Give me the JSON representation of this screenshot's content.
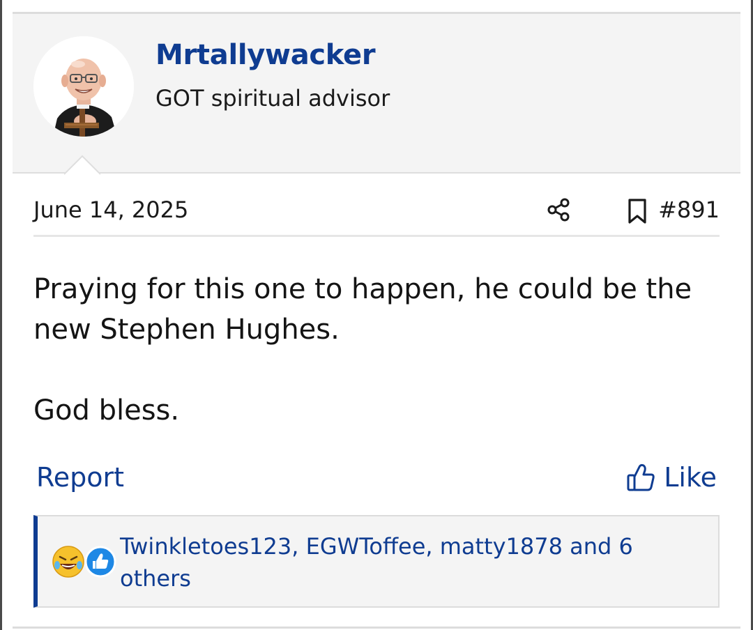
{
  "post": {
    "author": {
      "username": "Mrtallywacker",
      "user_title": "GOT spiritual advisor",
      "avatar": "avatar-bald-man-with-cross"
    },
    "date": "June 14, 2025",
    "post_number": "#891",
    "icons": {
      "share": "share-icon",
      "bookmark": "bookmark-icon",
      "like": "thumbs-up-icon"
    },
    "message_lines": [
      "Praying for this one to happen, he could be the new Stephen Hughes.",
      "God bless."
    ],
    "actions": {
      "report_label": "Report",
      "like_label": "Like"
    },
    "reactions": {
      "icons": [
        "laughing-emoji-icon",
        "like-reaction-icon"
      ],
      "summary": "Twinkletoes123, EGWToffee, matty1878 and 6 others"
    }
  },
  "colors": {
    "link": "#0f3c91",
    "header_background": "#f4f4f4",
    "border": "#dcdcdc"
  }
}
